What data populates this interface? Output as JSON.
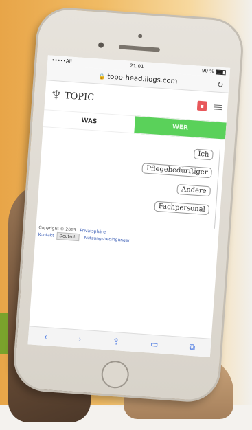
{
  "status_bar": {
    "carrier": "•••••All",
    "time": "21:01",
    "battery": "90 %"
  },
  "browser": {
    "url": "topo-head.ilogs.com"
  },
  "site": {
    "logo_text": "TOPIC"
  },
  "tabs": [
    {
      "label": "WAS",
      "active": false
    },
    {
      "label": "WER",
      "active": true
    }
  ],
  "who_options": [
    "Ich",
    "Pflegebedürftiger",
    "Andere",
    "Fachpersonal"
  ],
  "footer": {
    "copyright": "Copyright © 2015",
    "contact": "Kontakt",
    "privacy": "Privatsphäre",
    "terms": "Nutzungsbedingungen",
    "language": "Deutsch"
  },
  "colors": {
    "tab_active": "#5ad15a",
    "link": "#3a5db5",
    "badge": "#e8575a"
  },
  "icons": [
    "lock-icon",
    "reload-icon",
    "tree-logo-icon",
    "hamburger-icon",
    "back-icon",
    "forward-icon",
    "share-icon",
    "bookmarks-icon",
    "tabs-icon"
  ]
}
